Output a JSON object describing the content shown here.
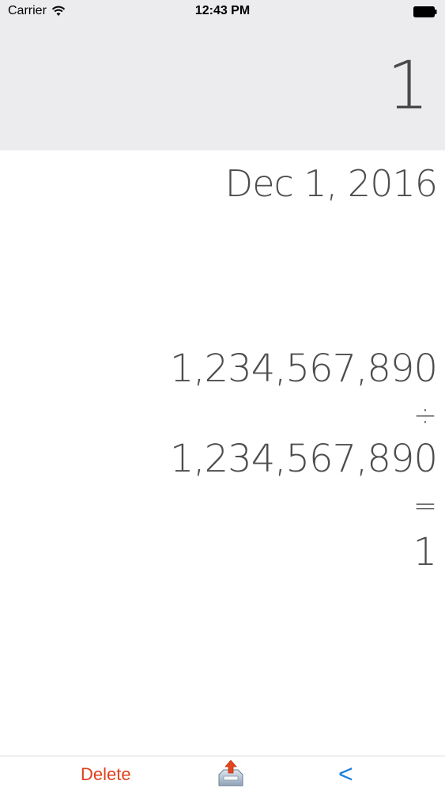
{
  "status_bar": {
    "carrier": "Carrier",
    "time": "12:43 PM",
    "wifi_icon": "wifi-icon",
    "battery_icon": "battery-icon"
  },
  "display": {
    "value": "1"
  },
  "tape": {
    "date": "Dec 1, 2016",
    "operand_a": "1,234,567,890",
    "operator": "÷",
    "operand_b": "1,234,567,890",
    "equals": "=",
    "result": "1"
  },
  "toolbar": {
    "delete_label": "Delete",
    "share_icon": "share-tray-icon",
    "back_label": "<"
  },
  "colors": {
    "delete": "#e0401d",
    "back": "#1b7fe0",
    "header_bg": "#ececef",
    "text": "#4d4d4d"
  }
}
